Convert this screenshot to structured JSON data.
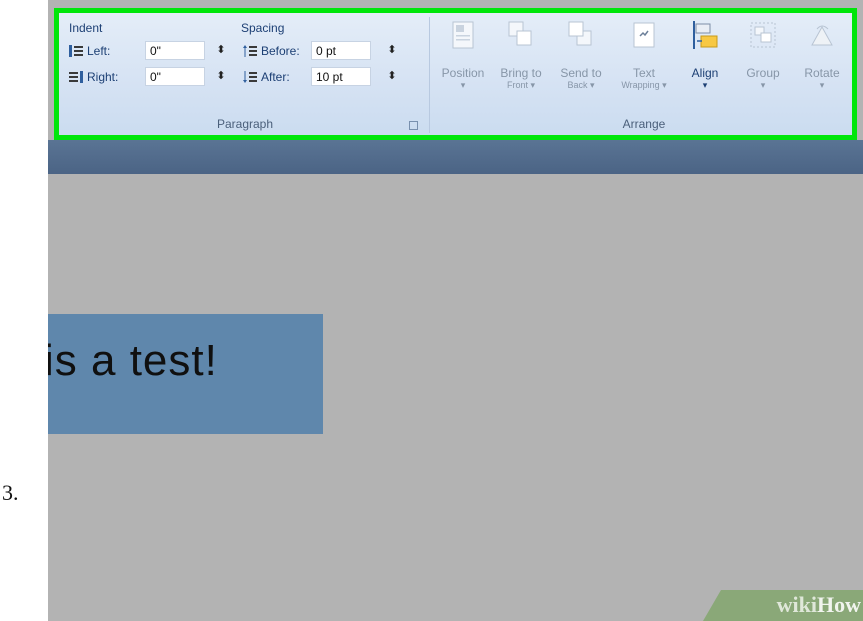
{
  "step_number": "3.",
  "ribbon": {
    "paragraph": {
      "indent_heading": "Indent",
      "spacing_heading": "Spacing",
      "left_label": "Left:",
      "left_value": "0\"",
      "right_label": "Right:",
      "right_value": "0\"",
      "before_label": "Before:",
      "before_value": "0 pt",
      "after_label": "After:",
      "after_value": "10 pt",
      "group_label": "Paragraph"
    },
    "arrange": {
      "group_label": "Arrange",
      "buttons": [
        {
          "line1": "Position",
          "line2": "▾",
          "icon": "position-icon",
          "enabled": false
        },
        {
          "line1": "Bring to",
          "line2": "Front ▾",
          "icon": "bring-to-front-icon",
          "enabled": false
        },
        {
          "line1": "Send to",
          "line2": "Back ▾",
          "icon": "send-to-back-icon",
          "enabled": false
        },
        {
          "line1": "Text",
          "line2": "Wrapping ▾",
          "icon": "text-wrapping-icon",
          "enabled": false
        },
        {
          "line1": "Align",
          "line2": "▾",
          "icon": "align-icon",
          "enabled": true
        },
        {
          "line1": "Group",
          "line2": "▾",
          "icon": "group-icon",
          "enabled": false
        },
        {
          "line1": "Rotate",
          "line2": "▾",
          "icon": "rotate-icon",
          "enabled": false
        }
      ]
    }
  },
  "document": {
    "textbox_text": "is a test!"
  },
  "watermark": {
    "part1": "wiki",
    "part2": "How"
  },
  "colors": {
    "highlight_border": "#00e60a",
    "textbox_fill": "#5f87ac",
    "canvas": "#b3b3b3"
  }
}
